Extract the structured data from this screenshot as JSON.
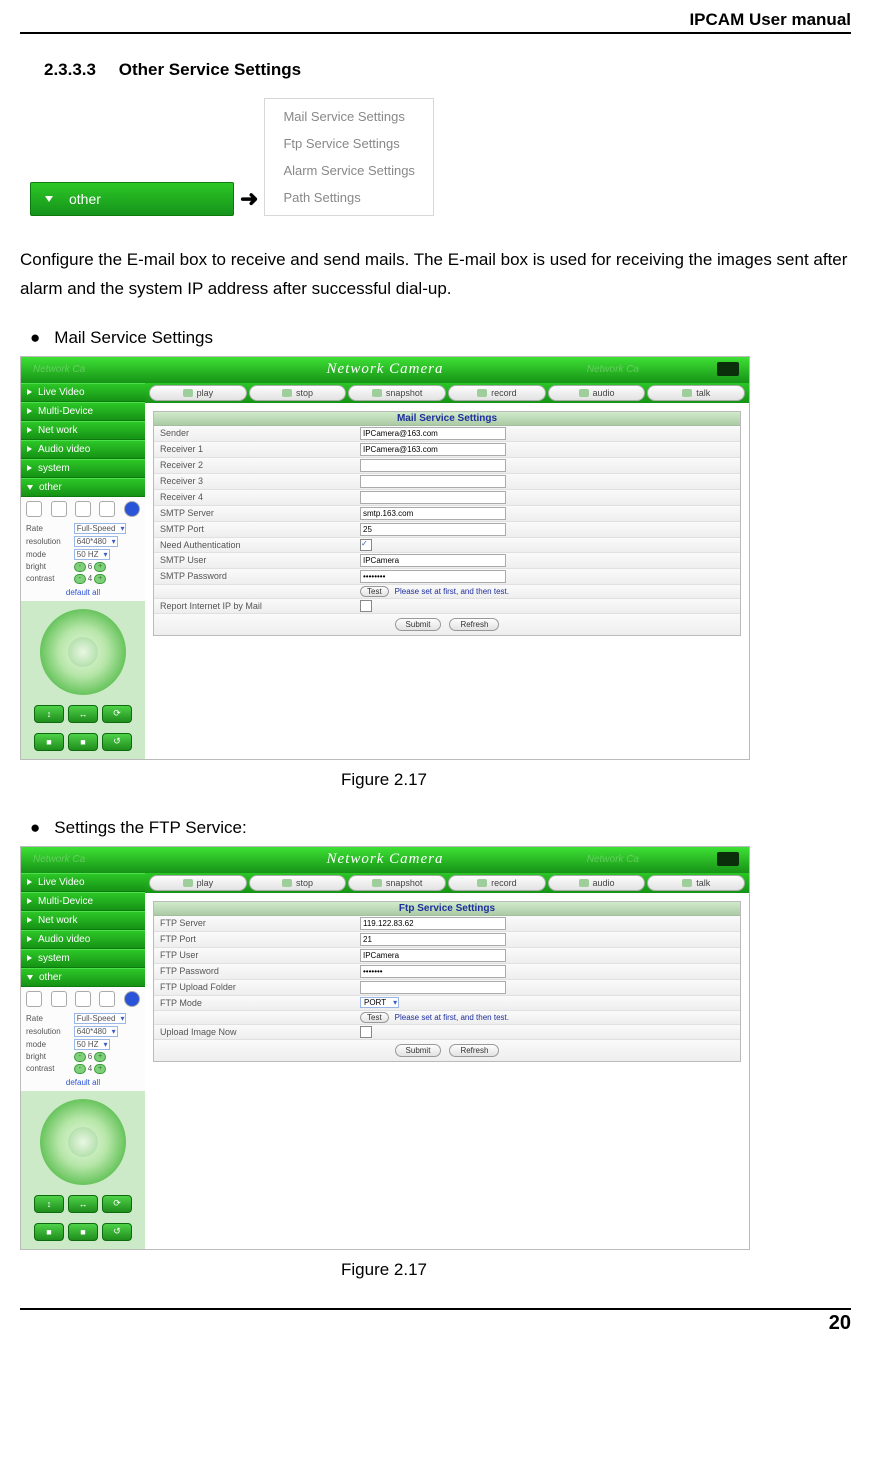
{
  "header": {
    "doc_title": "IPCAM User manual"
  },
  "section": {
    "number": "2.3.3.3",
    "title": "Other Service Settings"
  },
  "other_button": {
    "label": "other"
  },
  "service_list": [
    "Mail Service Settings",
    "Ftp Service Settings",
    "Alarm Service Settings",
    "Path Settings"
  ],
  "intro": "Configure the E-mail box to receive and send mails. The E-mail box is used for receiving the images sent after alarm and the system IP address after successful dial-up.",
  "bullet1": "Mail Service Settings",
  "bullet2": "Settings the FTP Service:",
  "caption1": "Figure 2.17",
  "caption2": "Figure 2.17",
  "page_number": "20",
  "nc_title": "Network Camera",
  "nav": [
    "Live Video",
    "Multi-Device",
    "Net work",
    "Audio video",
    "system",
    "other"
  ],
  "nav_params": {
    "rate_label": "Rate",
    "rate": "Full-Speed",
    "res_label": "resolution",
    "res": "640*480",
    "mode_label": "mode",
    "mode": "50 HZ",
    "bright_label": "bright",
    "bright": "6",
    "contrast_label": "contrast",
    "contrast": "4",
    "default": "default all"
  },
  "toolbar": [
    "play",
    "stop",
    "snapshot",
    "record",
    "audio",
    "talk"
  ],
  "mail": {
    "panel_title": "Mail Service Settings",
    "rows": {
      "sender": {
        "label": "Sender",
        "value": "IPCamera@163.com"
      },
      "r1": {
        "label": "Receiver 1",
        "value": "IPCamera@163.com"
      },
      "r2": {
        "label": "Receiver 2",
        "value": ""
      },
      "r3": {
        "label": "Receiver 3",
        "value": ""
      },
      "r4": {
        "label": "Receiver 4",
        "value": ""
      },
      "server": {
        "label": "SMTP Server",
        "value": "smtp.163.com"
      },
      "port": {
        "label": "SMTP Port",
        "value": "25"
      },
      "auth": {
        "label": "Need Authentication"
      },
      "user": {
        "label": "SMTP User",
        "value": "IPCamera"
      },
      "pass": {
        "label": "SMTP Password",
        "value": "••••••••"
      },
      "test": {
        "btn": "Test",
        "note": "Please set at first, and then test."
      },
      "report": {
        "label": "Report Internet IP by Mail"
      }
    },
    "submit": "Submit",
    "refresh": "Refresh"
  },
  "ftp": {
    "panel_title": "Ftp Service Settings",
    "rows": {
      "server": {
        "label": "FTP Server",
        "value": "119.122.83.62"
      },
      "port": {
        "label": "FTP Port",
        "value": "21"
      },
      "user": {
        "label": "FTP User",
        "value": "IPCamera"
      },
      "pass": {
        "label": "FTP Password",
        "value": "•••••••"
      },
      "folder": {
        "label": "FTP Upload Folder",
        "value": ""
      },
      "mode": {
        "label": "FTP Mode",
        "value": "PORT"
      },
      "test": {
        "btn": "Test",
        "note": "Please set at first, and then test."
      },
      "upload": {
        "label": "Upload Image Now"
      }
    },
    "submit": "Submit",
    "refresh": "Refresh"
  }
}
